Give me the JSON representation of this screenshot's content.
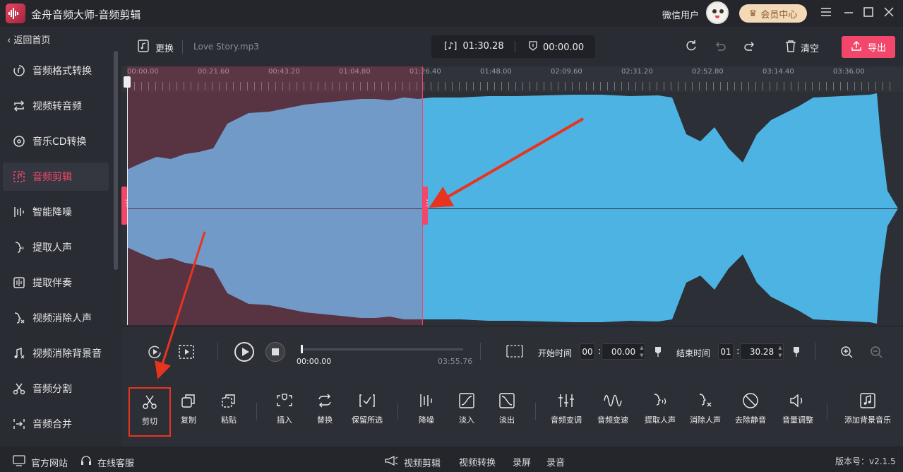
{
  "app": {
    "title": "金舟音频大师-音频剪辑",
    "user": "微信用户",
    "vip_label": "会员中心"
  },
  "sidebar": {
    "back_label": "返回首页",
    "items": [
      {
        "label": "音频格式转换",
        "icon": "music-convert-icon"
      },
      {
        "label": "视频转音频",
        "icon": "convert-arrows-icon"
      },
      {
        "label": "音乐CD转换",
        "icon": "cd-icon"
      },
      {
        "label": "音频剪辑",
        "icon": "music-edit-icon",
        "active": true
      },
      {
        "label": "智能降噪",
        "icon": "noise-bars-icon"
      },
      {
        "label": "提取人声",
        "icon": "voice-icon"
      },
      {
        "label": "提取伴奏",
        "icon": "accompaniment-icon"
      },
      {
        "label": "视频消除人声",
        "icon": "remove-voice-icon"
      },
      {
        "label": "视频消除背景音",
        "icon": "remove-bg-icon"
      },
      {
        "label": "音频分割",
        "icon": "scissors-icon"
      },
      {
        "label": "音频合并",
        "icon": "merge-icon"
      }
    ]
  },
  "toolbar": {
    "change_label": "更换",
    "file_name": "Love Story.mp3",
    "duration": "01:30.28",
    "position": "00:00.00",
    "clear_label": "清空",
    "export_label": "导出"
  },
  "ruler": {
    "labels": [
      "00:00.00",
      "00:21.60",
      "00:43.20",
      "01:04.80",
      "01:26.40",
      "01:48.00",
      "02:09.60",
      "02:31.20",
      "02:52.80",
      "03:14.40",
      "03:36.00"
    ]
  },
  "transport": {
    "current_time": "00:00.00",
    "total_time": "03:55.76",
    "start_label": "开始时间",
    "start_h": "00",
    "start_s": "00.00",
    "end_label": "结束时间",
    "end_h": "01",
    "end_s": "30.28"
  },
  "tools": [
    {
      "label": "剪切",
      "icon": "scissors-icon",
      "highlight": true
    },
    {
      "label": "复制",
      "icon": "copy-icon"
    },
    {
      "label": "粘贴",
      "icon": "paste-icon"
    },
    {
      "label": "插入",
      "icon": "insert-icon"
    },
    {
      "label": "替换",
      "icon": "replace-icon"
    },
    {
      "label": "保留所选",
      "icon": "keep-selection-icon"
    },
    {
      "label": "降噪",
      "icon": "denoise-icon"
    },
    {
      "label": "淡入",
      "icon": "fade-in-icon"
    },
    {
      "label": "淡出",
      "icon": "fade-out-icon"
    },
    {
      "label": "音频变调",
      "icon": "pitch-icon"
    },
    {
      "label": "音频变速",
      "icon": "speed-wave-icon"
    },
    {
      "label": "提取人声",
      "icon": "extract-voice-icon"
    },
    {
      "label": "消除人声",
      "icon": "remove-voice-icon"
    },
    {
      "label": "去除静音",
      "icon": "mute-icon"
    },
    {
      "label": "音量调整",
      "icon": "volume-icon"
    },
    {
      "label": "添加背景音乐",
      "icon": "bg-music-icon"
    }
  ],
  "status": {
    "website": "官方网站",
    "service": "在线客服",
    "video_edit": "视频剪辑",
    "video_convert": "视频转换",
    "record_screen": "录屏",
    "record_audio": "录音",
    "version": "版本号：v2.1.5"
  },
  "colors": {
    "accent": "#f2466a",
    "wave": "#4db3e3",
    "selection": "#6e3a4c",
    "annotation_arrow": "#e8341f"
  }
}
